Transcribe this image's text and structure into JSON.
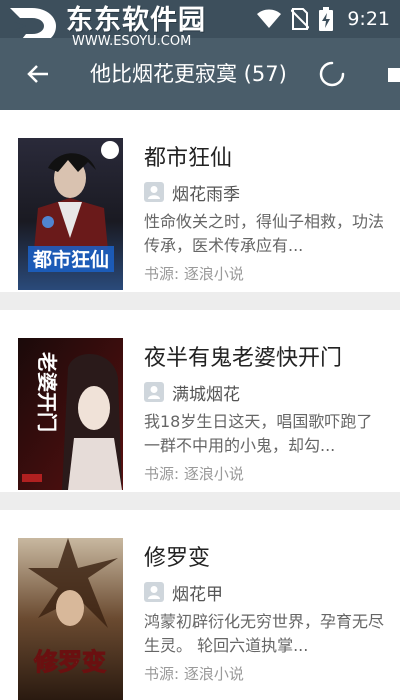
{
  "watermark": {
    "title": "东东软件园",
    "url": "WWW.ESOYU.COM"
  },
  "status_bar": {
    "time": "9:21",
    "icons": [
      "wifi-icon",
      "no-sim-icon",
      "battery-charging-icon"
    ]
  },
  "toolbar": {
    "title": "他比烟花更寂寞 (57)",
    "back_icon": "back-arrow-icon",
    "loading_icon": "loading-spinner-icon"
  },
  "books": [
    {
      "title": "都市狂仙",
      "author": "烟花雨季",
      "intro": "性命攸关之时，得仙子相救，功法传承，医术传承应有...",
      "source": "书源: 逐浪小说",
      "cover_text": "都市狂仙"
    },
    {
      "title": "夜半有鬼老婆快开门",
      "author": "满城烟花",
      "intro": "我18岁生日这天，唱国歌吓跑了一群不中用的小鬼，却勾...",
      "source": "书源: 逐浪小说",
      "cover_text": "老婆开门"
    },
    {
      "title": "修罗变",
      "author": "烟花甲",
      "intro": "鸿蒙初辟衍化无穷世界，孕育无尽生灵。 轮回六道执掌...",
      "source": "书源: 逐浪小说",
      "cover_text": "修罗变"
    }
  ],
  "colors": {
    "toolbar": "#4a5d6a",
    "statusbar": "#3d4f5c",
    "list_background": "#ededed",
    "card_background": "#ffffff"
  }
}
